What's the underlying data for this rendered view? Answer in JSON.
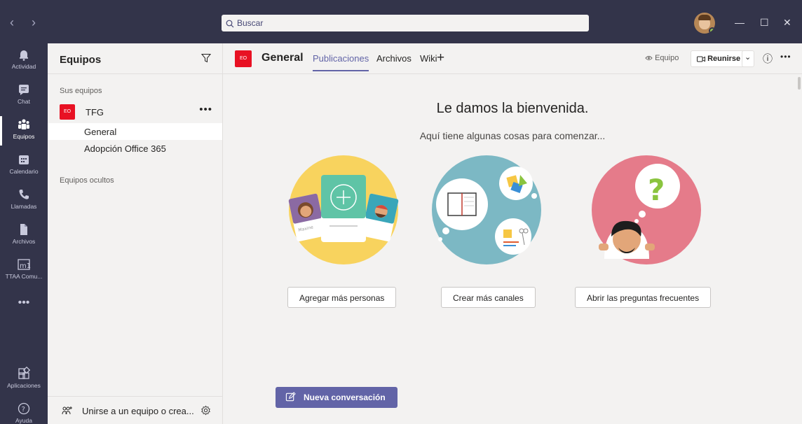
{
  "titlebar": {
    "back": "‹",
    "forward": "›",
    "search_placeholder": "Buscar",
    "minimize": "—",
    "maximize": "☐",
    "close": "✕"
  },
  "rail": {
    "items": [
      {
        "label": "Actividad",
        "icon": "bell-icon"
      },
      {
        "label": "Chat",
        "icon": "chat-icon"
      },
      {
        "label": "Equipos",
        "icon": "teams-icon"
      },
      {
        "label": "Calendario",
        "icon": "calendar-icon"
      },
      {
        "label": "Llamadas",
        "icon": "phone-icon"
      },
      {
        "label": "Archivos",
        "icon": "files-icon"
      },
      {
        "label": "TTAA Comu...",
        "icon": "app-icon"
      },
      {
        "label": "•••",
        "icon": "more-icon"
      },
      {
        "label": "Aplicaciones",
        "icon": "apps-icon"
      },
      {
        "label": "Ayuda",
        "icon": "help-icon"
      }
    ],
    "app_icon_text": "m1"
  },
  "teams_pane": {
    "title": "Equipos",
    "section_yours": "Sus equipos",
    "team": {
      "badge": "EO",
      "name": "TFG",
      "more": "•••"
    },
    "channels": [
      "General",
      "Adopción Office 365"
    ],
    "section_hidden": "Equipos ocultos",
    "join_label": "Unirse a un equipo o crea..."
  },
  "channel_header": {
    "badge": "EO",
    "title": "General",
    "tabs": [
      "Publicaciones",
      "Archivos",
      "Wiki"
    ],
    "add_tab": "+",
    "team_button": "Equipo",
    "meet_button": "Reunirse",
    "meet_dropdown": "⌄",
    "info": "ⓘ",
    "more": "•••"
  },
  "welcome": {
    "title": "Le damos la bienvenida.",
    "subtitle": "Aquí tiene algunas cosas para comenzar...",
    "cards": [
      {
        "label": "Agregar más personas",
        "illustration": "people-illustration",
        "color": "#f8d35e"
      },
      {
        "label": "Crear más canales",
        "illustration": "channels-illustration",
        "color": "#7cb8c4"
      },
      {
        "label": "Abrir las preguntas frecuentes",
        "illustration": "faq-illustration",
        "color": "#e57b8a"
      }
    ],
    "people_card_text": "Maxine"
  },
  "compose": {
    "new_conversation": "Nueva conversación"
  },
  "colors": {
    "accent": "#6264a7",
    "rail": "#33344a",
    "badge": "#e81123"
  }
}
